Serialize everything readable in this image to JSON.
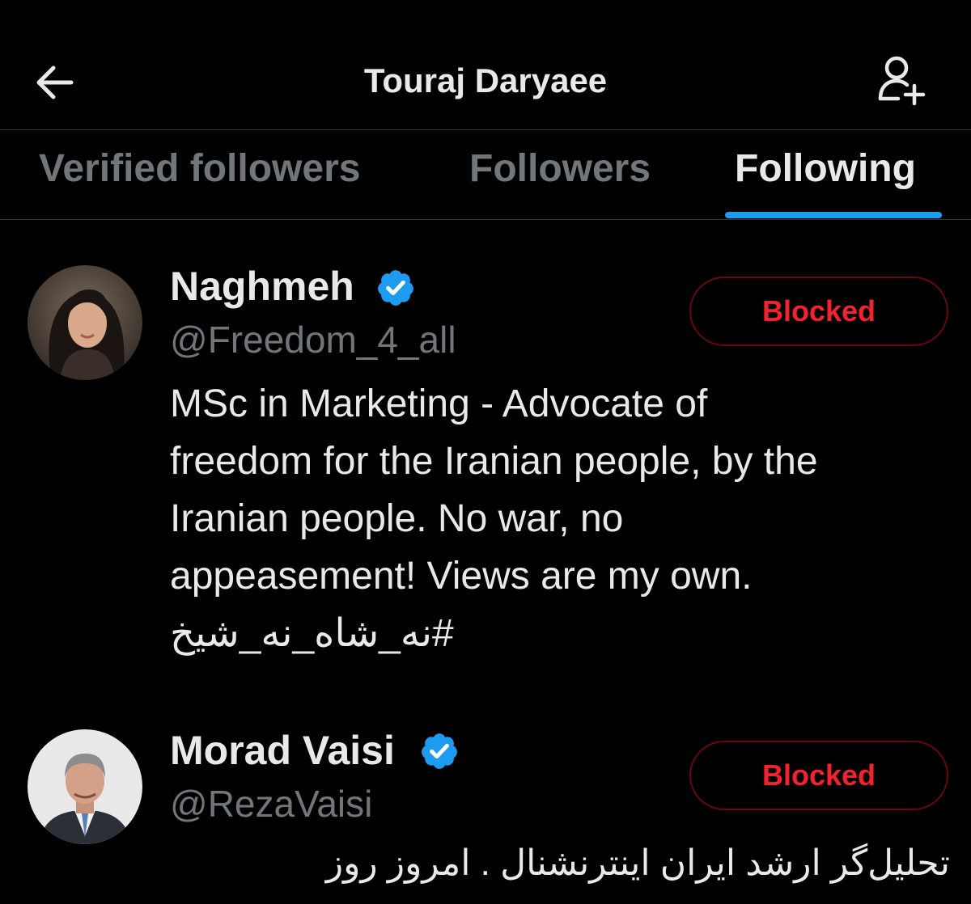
{
  "header": {
    "title": "Touraj Daryaee",
    "back_icon": "arrow-left-icon",
    "add_user_icon": "person-plus-icon"
  },
  "tabs": [
    {
      "label": "Verified followers",
      "active": false
    },
    {
      "label": "Followers",
      "active": false
    },
    {
      "label": "Following",
      "active": true
    }
  ],
  "users": [
    {
      "display_name": "Naghmeh",
      "verified": true,
      "handle": "@Freedom_4_all",
      "button_label": "Blocked",
      "bio_lines": [
        "MSc in Marketing - Advocate of",
        "freedom for the Iranian people, by the",
        "Iranian people. No war, no",
        "appeasement! Views are my own."
      ],
      "bio_hashtag": "#نه_شاه_نه_شیخ"
    },
    {
      "display_name": "Morad Vaisi",
      "verified": true,
      "handle": "@RezaVaisi",
      "button_label": "Blocked",
      "bio_rtl": "تحلیل‌گر ارشد ایران اینترنشنال . امروز روز"
    }
  ],
  "colors": {
    "background": "#000000",
    "text_primary": "#e7e9ea",
    "text_secondary": "#71767b",
    "accent": "#1d9bf0",
    "blocked_red": "#f4212e",
    "blocked_border": "#67070f",
    "divider": "#2f3336"
  }
}
